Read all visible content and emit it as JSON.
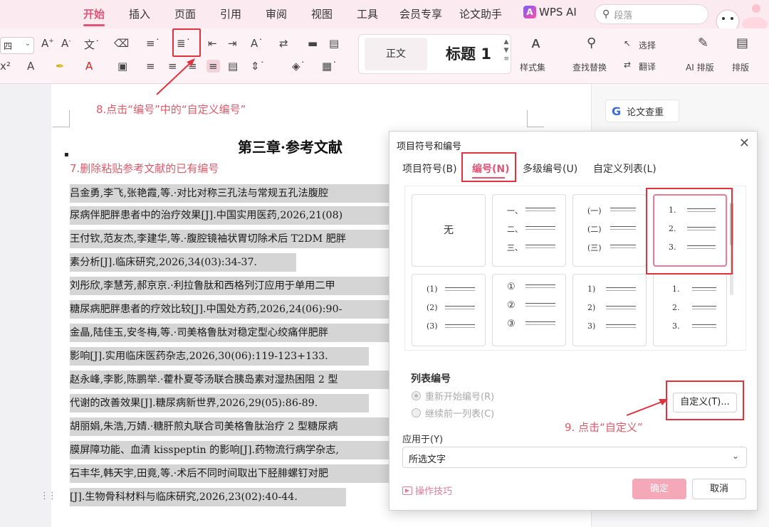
{
  "menu": {
    "tabs": [
      "开始",
      "插入",
      "页面",
      "引用",
      "审阅",
      "视图",
      "工具",
      "会员专享",
      "论文助手"
    ],
    "active_tab": "开始",
    "wps_ai": "WPS AI",
    "search_placeholder": "段落"
  },
  "ribbon": {
    "font_size": "四",
    "style_normal": "正文",
    "style_heading": "标题 1",
    "styles_label": "样式集",
    "find_replace": "查找替换",
    "select": "选择",
    "translate": "翻译",
    "ai_layout": "AI 排版",
    "layout": "排版"
  },
  "annotations": {
    "step8": "8.点击“编号”中的“自定义编号”",
    "step7": "7.删除粘贴参考文献的已有编号",
    "step9": "9. 点击“自定义”"
  },
  "document": {
    "title": "第三章·参考文献",
    "lines": [
      "吕金勇,李飞,张艳霞,等.·对比对称三孔法与常规五孔法腹腔",
      "尿病伴肥胖患者中的治疗效果[J].中国实用医药,2026,21(08)",
      "王付钦,范友杰,李建华,等.·腹腔镜袖状胃切除术后 T2DM 肥胖",
      "素分析[J].临床研究,2026,34(03):34-37.",
      "刘彤欣,李慧芳,郝京京.·利拉鲁肽和西格列汀应用于单用二甲",
      "糖尿病肥胖患者的疗效比较[J].中国处方药,2026,24(06):90-",
      "金晶,陆佳玉,安冬梅,等.·司美格鲁肽对稳定型心绞痛伴肥胖",
      "影响[J].实用临床医药杂志,2026,30(06):119-123+133.",
      "赵永峰,李影,陈鹏举.·藿朴夏苓汤联合胰岛素对湿热困阻 2 型",
      "代谢的改善效果[J].糖尿病新世界,2026,29(05):86-89.",
      "胡丽娟,朱浩,万婧.·糖肝煎丸联合司美格鲁肽治疗 2 型糖尿病",
      "膜屏障功能、血清 kisspeptin 的影响[J].药物流行病学杂志,",
      "石丰华,韩天宇,田竟,等.·术后不同时间取出下胫腓螺钉对肥",
      "[J].生物骨科材料与临床研究,2026,23(02):40-44."
    ]
  },
  "right_pane": {
    "paper_check": "论文查重"
  },
  "dialog": {
    "title": "项目符号和编号",
    "tabs": [
      "项目符号(B)",
      "编号(N)",
      "多级编号(U)",
      "自定义列表(L)"
    ],
    "active_tab": "编号(N)",
    "none_label": "无",
    "styles": {
      "chinese": [
        "一、",
        "二、",
        "三、"
      ],
      "chinese_paren": [
        "(一)",
        "(二)",
        "(三)"
      ],
      "arabic_dot": [
        "1.",
        "2.",
        "3."
      ],
      "arabic_paren": [
        "(1)",
        "(2)",
        "(3)"
      ],
      "circled": [
        "①",
        "②",
        "③"
      ],
      "arabic_half_paren": [
        "1)",
        "2)",
        "3)"
      ],
      "arabic_dot_indent": [
        "1.",
        "2.",
        "3."
      ]
    },
    "list_numbering_label": "列表编号",
    "restart_numbering": "重新开始编号(R)",
    "continue_numbering": "继续前一列表(C)",
    "custom_button": "自定义(T)...",
    "apply_to_label": "应用于(Y)",
    "apply_to_value": "所选文字",
    "tips": "操作技巧",
    "ok": "确定",
    "cancel": "取消"
  },
  "colors": {
    "accent": "#e05577",
    "highlight_box": "#e1323e",
    "annotation_text": "#d95b6a",
    "menubar_bg": "#fbeaf0"
  }
}
